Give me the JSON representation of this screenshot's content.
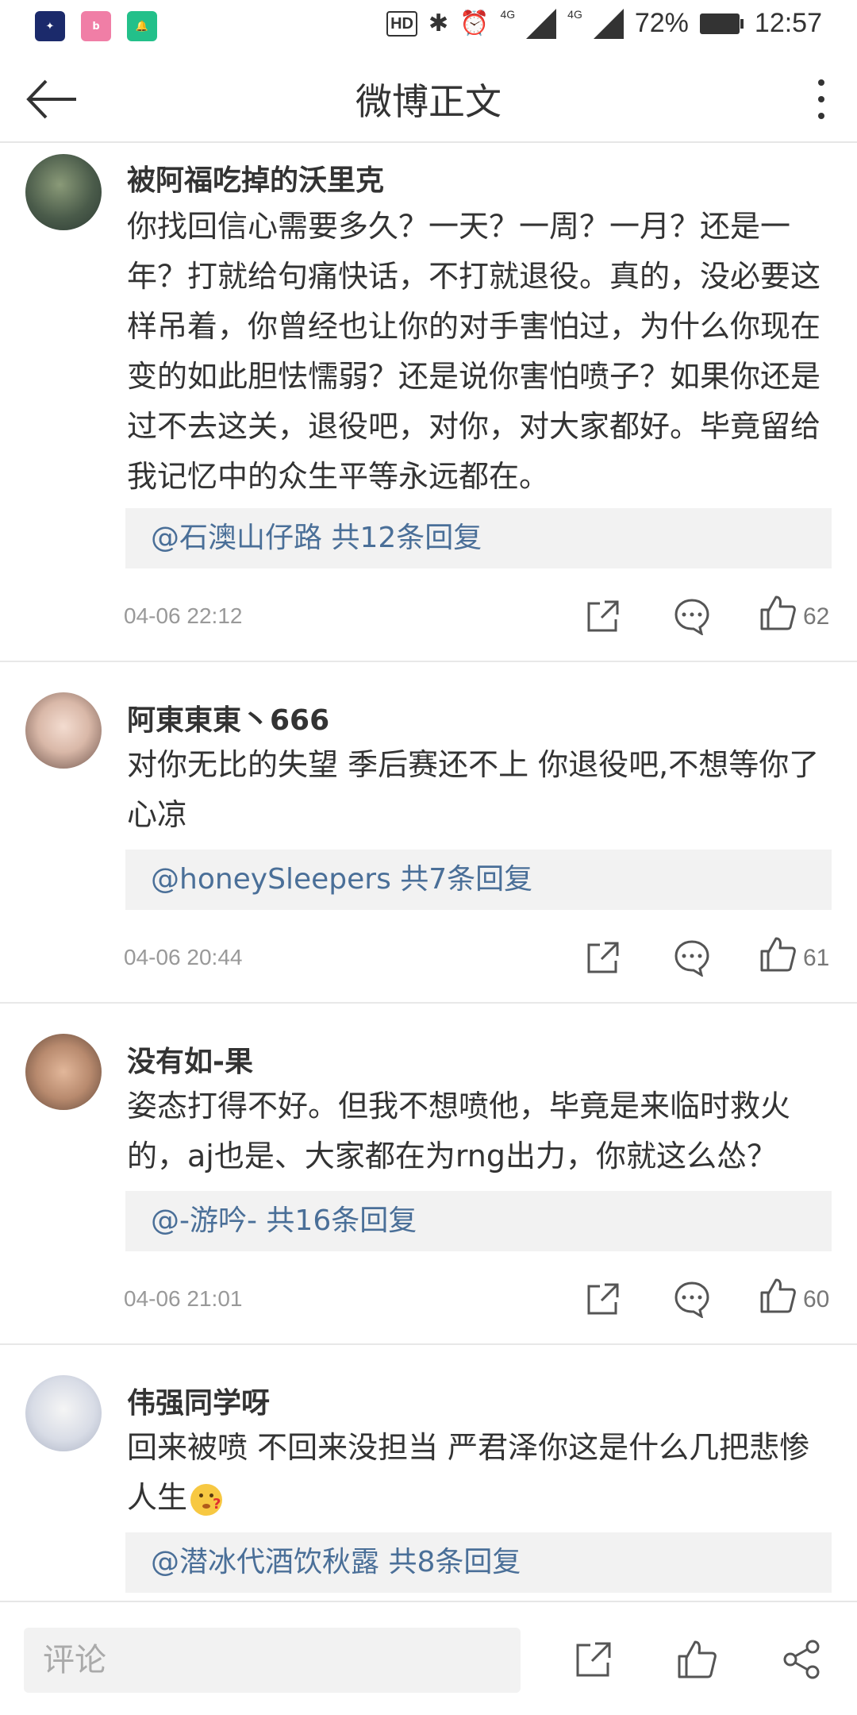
{
  "status_bar": {
    "hd": "HD",
    "net1": "4G",
    "net2": "4G",
    "battery": "72%",
    "time": "12:57"
  },
  "nav": {
    "title": "微博正文"
  },
  "comments": [
    {
      "name": "被阿福吃掉的沃里克",
      "text": "你找回信心需要多久？一天？一周？一月？还是一年？打就给句痛快话，不打就退役。真的，没必要这样吊着，你曾经也让你的对手害怕过，为什么你现在变的如此胆怯懦弱？还是说你害怕喷子？如果你还是过不去这关，退役吧，对你，对大家都好。毕竟留给我记忆中的众生平等永远都在。",
      "reply": "@石澳山仔路 共12条回复",
      "time": "04-06 22:12",
      "likes": "62"
    },
    {
      "name": "阿東東東丶666",
      "text": "对你无比的失望 季后赛还不上 你退役吧,不想等你了 心凉",
      "reply": "@honeySleepers 共7条回复",
      "time": "04-06 20:44",
      "likes": "61"
    },
    {
      "name": "没有如-果",
      "text": "姿态打得不好。但我不想喷他，毕竟是来临时救火的，aj也是、大家都在为rng出力，你就这么怂？",
      "reply": "@-游吟- 共16条回复",
      "time": "04-06 21:01",
      "likes": "60"
    },
    {
      "name": "伟强同学呀",
      "text": "回来被喷 不回来没担当 严君泽你这是什么几把悲惨人生",
      "reply": "@潜冰代酒饮秋露 共8条回复",
      "time": "",
      "likes": ""
    }
  ],
  "bottom": {
    "placeholder": "评论"
  }
}
